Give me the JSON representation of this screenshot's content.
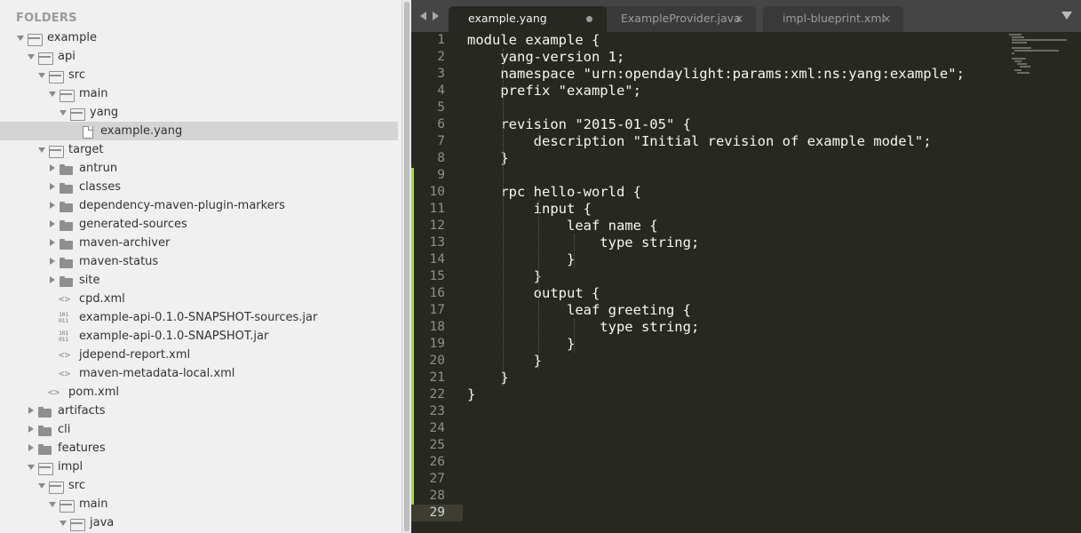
{
  "sidebar": {
    "header": "FOLDERS",
    "items": [
      {
        "label": "example",
        "type": "folder",
        "expanded": true,
        "depth": 0
      },
      {
        "label": "api",
        "type": "folder",
        "expanded": true,
        "depth": 1
      },
      {
        "label": "src",
        "type": "folder",
        "expanded": true,
        "depth": 2
      },
      {
        "label": "main",
        "type": "folder",
        "expanded": true,
        "depth": 3
      },
      {
        "label": "yang",
        "type": "folder",
        "expanded": true,
        "depth": 4
      },
      {
        "label": "example.yang",
        "type": "file",
        "depth": 5,
        "selected": true
      },
      {
        "label": "target",
        "type": "folder",
        "expanded": true,
        "depth": 2
      },
      {
        "label": "antrun",
        "type": "folder",
        "expanded": false,
        "depth": 3
      },
      {
        "label": "classes",
        "type": "folder",
        "expanded": false,
        "depth": 3
      },
      {
        "label": "dependency-maven-plugin-markers",
        "type": "folder",
        "expanded": false,
        "depth": 3
      },
      {
        "label": "generated-sources",
        "type": "folder",
        "expanded": false,
        "depth": 3
      },
      {
        "label": "maven-archiver",
        "type": "folder",
        "expanded": false,
        "depth": 3
      },
      {
        "label": "maven-status",
        "type": "folder",
        "expanded": false,
        "depth": 3
      },
      {
        "label": "site",
        "type": "folder",
        "expanded": false,
        "depth": 3
      },
      {
        "label": "cpd.xml",
        "type": "xml",
        "depth": 3
      },
      {
        "label": "example-api-0.1.0-SNAPSHOT-sources.jar",
        "type": "binary",
        "depth": 3
      },
      {
        "label": "example-api-0.1.0-SNAPSHOT.jar",
        "type": "binary",
        "depth": 3
      },
      {
        "label": "jdepend-report.xml",
        "type": "xml",
        "depth": 3
      },
      {
        "label": "maven-metadata-local.xml",
        "type": "xml",
        "depth": 3
      },
      {
        "label": "pom.xml",
        "type": "xml",
        "depth": 2
      },
      {
        "label": "artifacts",
        "type": "folder",
        "expanded": false,
        "depth": 1
      },
      {
        "label": "cli",
        "type": "folder",
        "expanded": false,
        "depth": 1
      },
      {
        "label": "features",
        "type": "folder",
        "expanded": false,
        "depth": 1
      },
      {
        "label": "impl",
        "type": "folder",
        "expanded": true,
        "depth": 1
      },
      {
        "label": "src",
        "type": "folder",
        "expanded": true,
        "depth": 2
      },
      {
        "label": "main",
        "type": "folder",
        "expanded": true,
        "depth": 3
      },
      {
        "label": "java",
        "type": "folder",
        "expanded": true,
        "depth": 4
      }
    ]
  },
  "tabs": [
    {
      "label": "example.yang",
      "active": true,
      "dirty": true
    },
    {
      "label": "ExampleProvider.java",
      "active": false
    },
    {
      "label": "impl-blueprint.xml",
      "active": false
    }
  ],
  "icons": {
    "close": "×",
    "code": "<>",
    "binary": "101\n011"
  },
  "editor": {
    "current_line": 29,
    "lines": [
      "module example {",
      "    yang-version 1;",
      "    namespace \"urn:opendaylight:params:xml:ns:yang:example\";",
      "    prefix \"example\";",
      "",
      "    revision \"2015-01-05\" {",
      "        description \"Initial revision of example model\";",
      "    }",
      "",
      "    rpc hello-world {",
      "        input {",
      "            leaf name {",
      "                type string;",
      "            }",
      "        }",
      "        output {",
      "            leaf greeting {",
      "                type string;",
      "            }",
      "        }",
      "    }",
      "}",
      "",
      "",
      "",
      "",
      "",
      "",
      ""
    ]
  },
  "colors": {
    "editor_bg": "#272822",
    "sidebar_bg": "#f0f0f0",
    "selection": "#d4d4d4",
    "gutter_marker": "#a6d932"
  }
}
